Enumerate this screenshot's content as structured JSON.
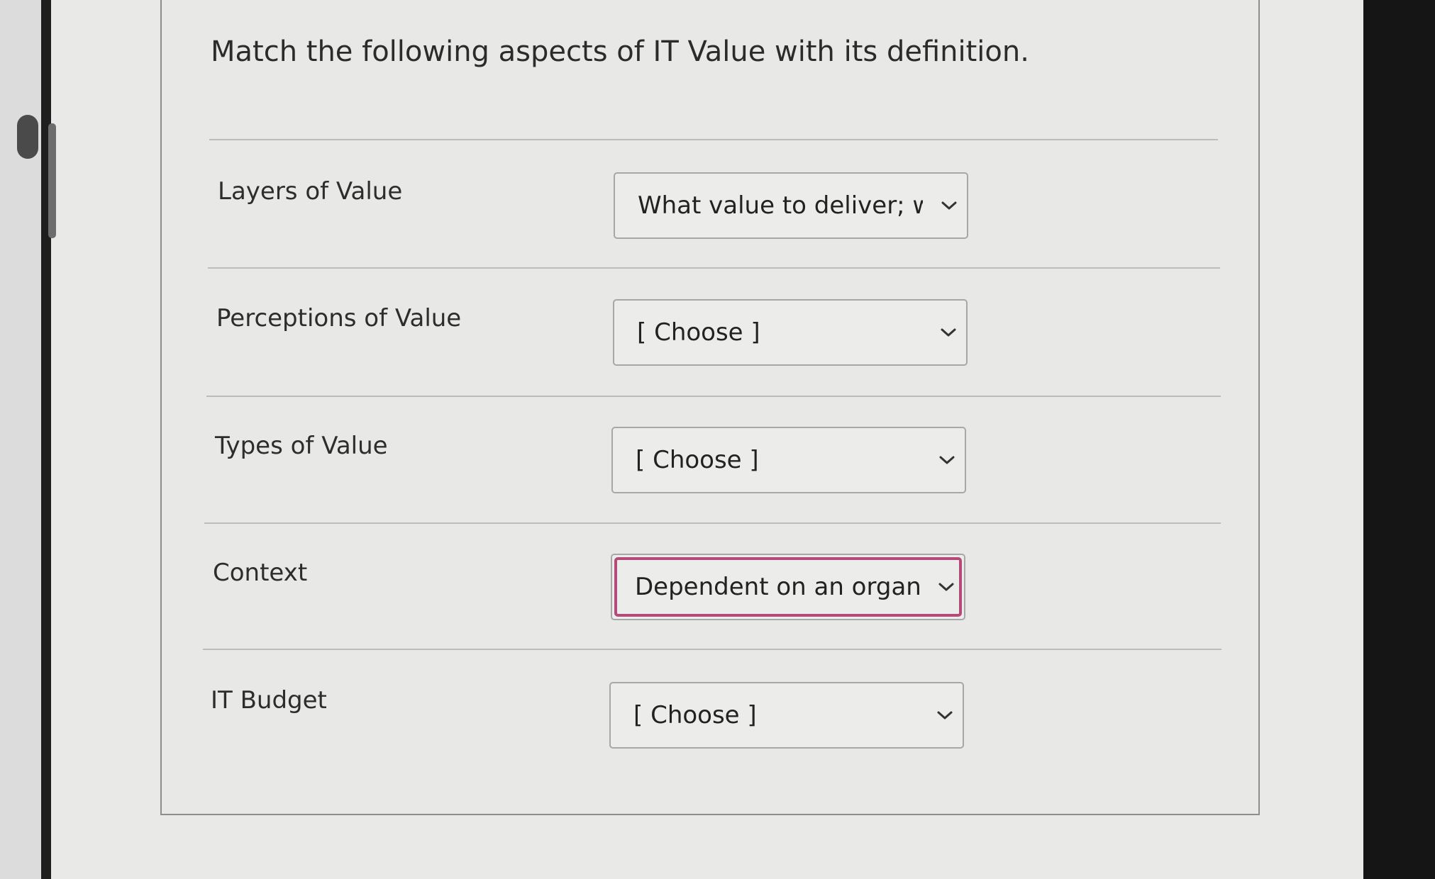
{
  "question": {
    "text": "Match the following aspects of IT Value with its definition."
  },
  "rows": [
    {
      "label": "Layers of Value",
      "selected": "What value to deliver; wh"
    },
    {
      "label": "Perceptions of Value",
      "selected": "[ Choose ]"
    },
    {
      "label": "Types of Value",
      "selected": "[ Choose ]"
    },
    {
      "label": "Context",
      "selected": "Dependent on an organiza"
    },
    {
      "label": "IT Budget",
      "selected": "[ Choose ]"
    }
  ],
  "colors": {
    "focus_ring": "#b44a7a",
    "card_background": "#e8e8e6",
    "text": "#2b2b2b"
  },
  "icons": {
    "dropdown": "chevron-down-icon"
  }
}
